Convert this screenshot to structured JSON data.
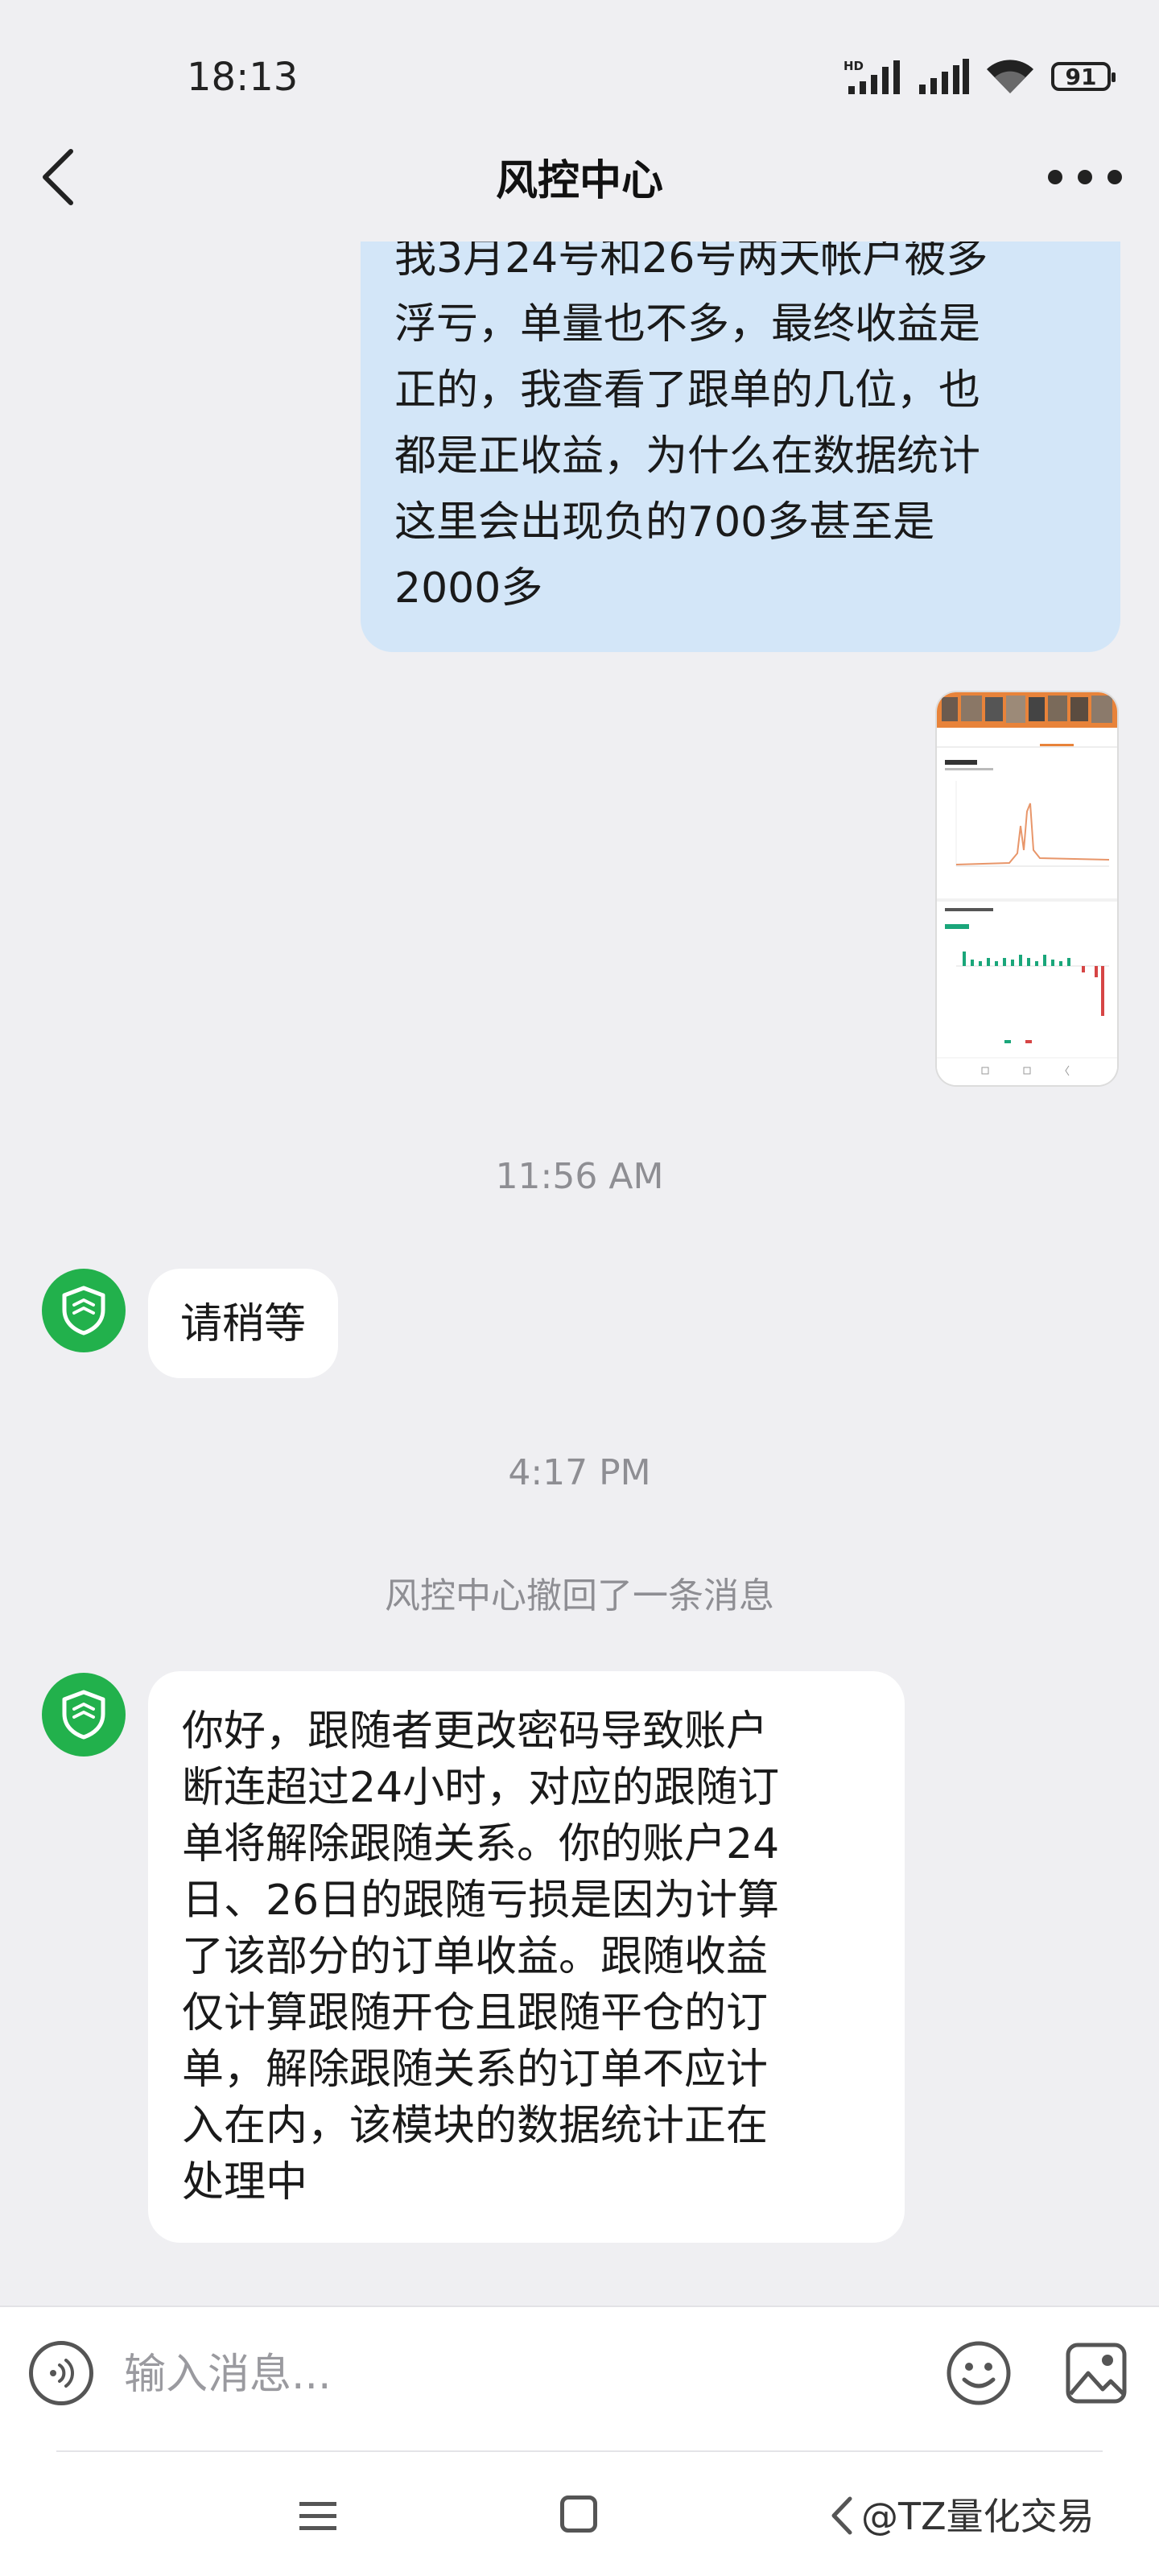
{
  "status_bar": {
    "time": "18:13",
    "network_badge": "HD",
    "battery_level": "91"
  },
  "header": {
    "title": "风控中心",
    "back_icon": "chevron-left-icon",
    "more_icon": "more-horizontal-icon"
  },
  "messages": {
    "outgoing_1": {
      "lines": [
        "我3月24号和26号两天帐户被多",
        "浮亏，单量也不多，最终收益是",
        "正的，我查看了跟单的几位，也",
        "都是正收益，为什么在数据统计",
        "这里会出现负的700多甚至是",
        "2000多"
      ]
    },
    "outgoing_2_image": {
      "description_icon": "screenshot-thumbnail"
    },
    "timestamp_1": "11:56 AM",
    "incoming_1": {
      "text": "请稍等"
    },
    "timestamp_2": "4:17 PM",
    "system_note": "风控中心撤回了一条消息",
    "incoming_2": {
      "lines": [
        "你好，跟随者更改密码导致账户",
        "断连超过24小时，对应的跟随订",
        "单将解除跟随关系。你的账户24",
        "日、26日的跟随亏损是因为计算",
        "了该部分的订单收益。跟随收益",
        "仅计算跟随开仓且跟随平仓的订",
        "单，解除跟随关系的订单不应计",
        "入在内，该模块的数据统计正在",
        "处理中"
      ]
    }
  },
  "input_bar": {
    "placeholder": "输入消息..."
  },
  "nav_bar": {
    "watermark": "@TZ量化交易"
  },
  "colors": {
    "background": "#efeff2",
    "outgoing_bubble": "#d3e6f8",
    "incoming_bubble": "#ffffff",
    "avatar": "#22b14c",
    "secondary_text": "#8e8e93"
  }
}
